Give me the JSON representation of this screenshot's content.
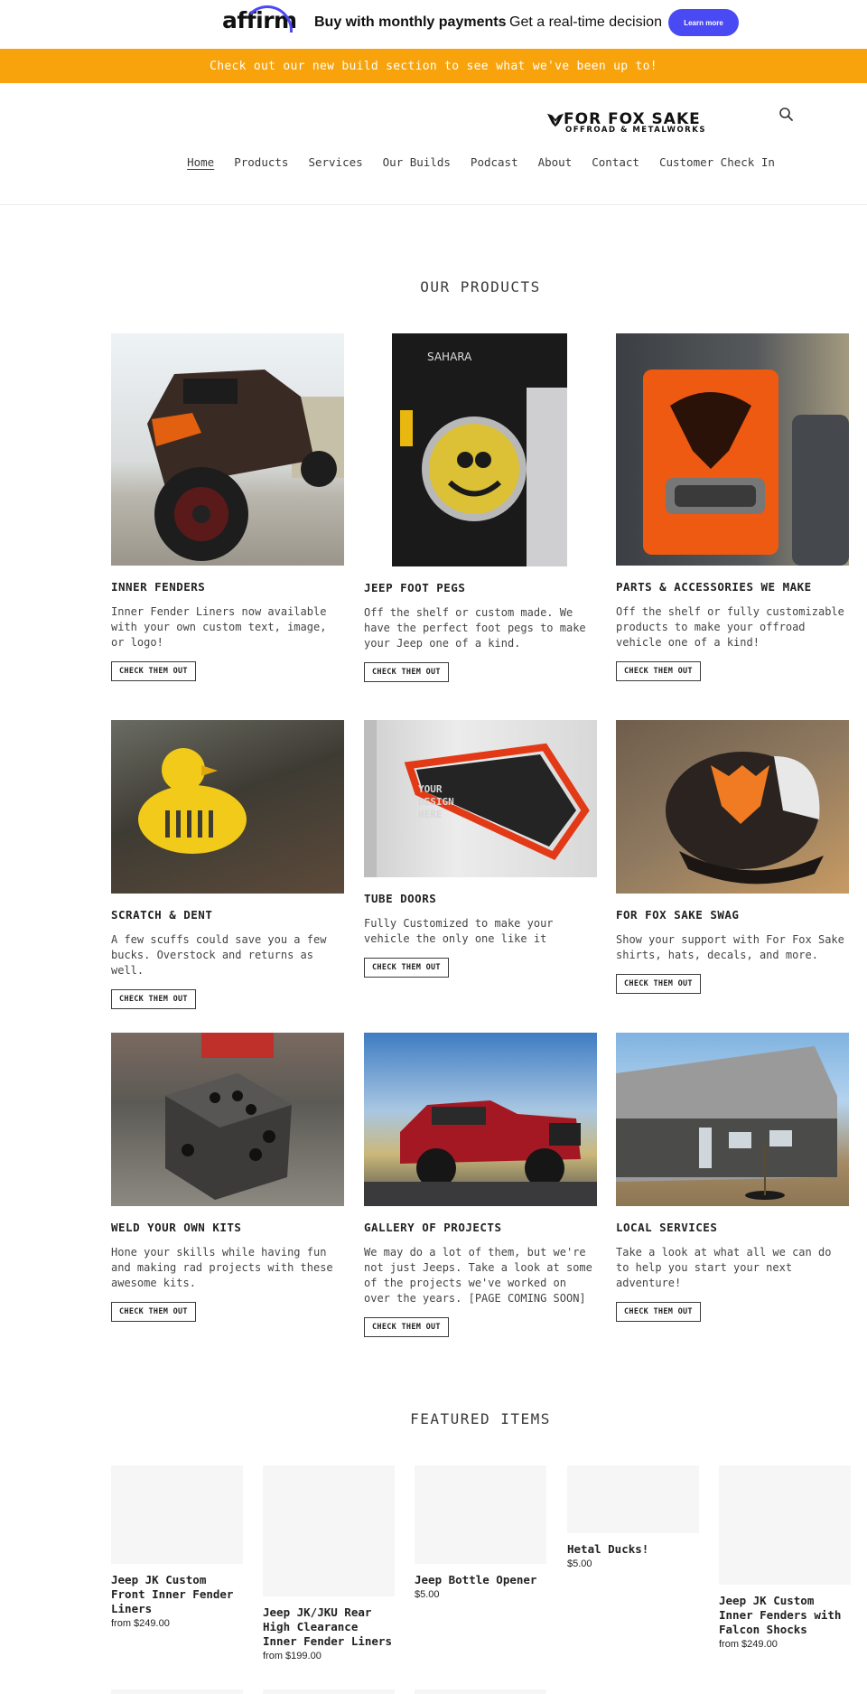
{
  "affirm": {
    "logo": "affirm",
    "headline": "Buy with monthly payments",
    "subline": "Get a real-time decision",
    "button": "Learn more"
  },
  "announcement": "Check out our new build section to see what we've been up to!",
  "header": {
    "logo_line1": "FOR FOX SAKE",
    "logo_line2": "OFFROAD & METALWORKS",
    "nav": [
      "Home",
      "Products",
      "Services",
      "Our Builds",
      "Podcast",
      "About",
      "Contact",
      "Customer Check In"
    ]
  },
  "products_title": "OUR PRODUCTS",
  "products": [
    {
      "title": "INNER FENDERS",
      "text": "Inner Fender Liners now available with your own custom text, image, or logo!",
      "button": "CHECK THEM OUT"
    },
    {
      "title": "JEEP FOOT PEGS",
      "text": "Off the shelf or custom made. We have the perfect foot pegs to make your Jeep one of a kind.",
      "button": "CHECK THEM OUT"
    },
    {
      "title": "PARTS & ACCESSORIES WE MAKE",
      "text": "Off the shelf or fully customizable products to make your offroad vehicle one of a kind!",
      "button": "CHECK THEM OUT"
    },
    {
      "title": "SCRATCH & DENT",
      "text": "A few scuffs could save you a few bucks. Overstock and returns as well.",
      "button": "CHECK THEM OUT"
    },
    {
      "title": "TUBE DOORS",
      "text": "Fully Customized to make your vehicle the only one like it",
      "button": "CHECK THEM OUT",
      "image_text": [
        "YOUR",
        "DESIGN",
        "HERE"
      ]
    },
    {
      "title": "FOR FOX SAKE SWAG",
      "text": "Show your support with For Fox Sake shirts, hats, decals, and more.",
      "button": "CHECK THEM OUT"
    },
    {
      "title": "WELD YOUR OWN KITS",
      "text": "Hone your skills while having fun and making rad projects with these awesome kits.",
      "button": "CHECK THEM OUT"
    },
    {
      "title": "GALLERY OF PROJECTS",
      "text": "We may do a lot of them, but we're not just Jeeps. Take a look at some of the projects we've worked on over the years. [PAGE COMING SOON]",
      "button": "CHECK THEM OUT"
    },
    {
      "title": "LOCAL SERVICES",
      "text": "Take a look at what all we can do to help you start your next adventure!",
      "button": "CHECK THEM OUT"
    }
  ],
  "featured_title": "FEATURED ITEMS",
  "featured": [
    {
      "title": "Jeep JK Custom Front Inner Fender Liners",
      "price": "from $249.00"
    },
    {
      "title": "Jeep JK/JKU Rear High Clearance Inner Fender Liners",
      "price": "from $199.00"
    },
    {
      "title": "Jeep Bottle Opener",
      "price": "$5.00"
    },
    {
      "title": "Hetal Ducks!",
      "price": "$5.00"
    },
    {
      "title": "Jeep JK Custom Inner Fenders with Falcon Shocks",
      "price": "from $249.00"
    }
  ],
  "colors": {
    "announcement_bg": "#f8a30c",
    "affirm_blue": "#4a4af4"
  }
}
